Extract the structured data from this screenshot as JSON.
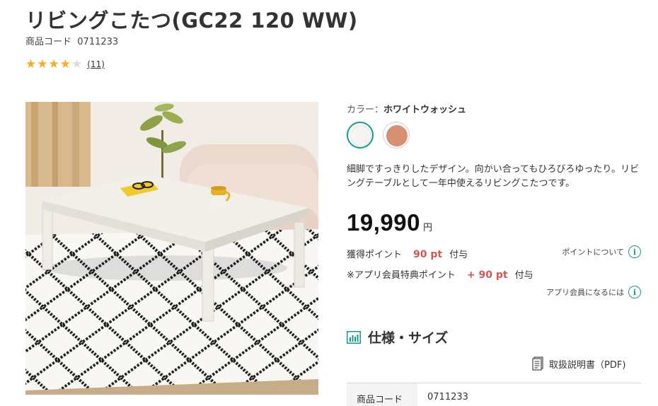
{
  "product": {
    "title": "リビングこたつ(GC22 120 WW)",
    "code_label": "商品コード",
    "code": "0711233",
    "rating": 4,
    "rating_max": 5,
    "review_count": "(11)"
  },
  "color": {
    "label": "カラー：",
    "selected": "ホワイトウォッシュ",
    "swatches": [
      {
        "name": "ホワイトウォッシュ",
        "hex": "#f7f5f2",
        "selected": true
      },
      {
        "name": "brown",
        "hex": "#d99072",
        "selected": false
      }
    ]
  },
  "description": "細脚ですっきりしたデザイン。向かい合ってもひろびろゆったり。リビングテーブルとして一年中使えるリビングこたつです。",
  "price": {
    "value": "19,990",
    "unit": "円"
  },
  "points": {
    "earn_label": "獲得ポイント",
    "earn_value": "90 pt",
    "earn_suffix": "付与",
    "about_link": "ポイントについて",
    "app_label": "※アプリ会員特典ポイント",
    "app_value": "+ 90 pt",
    "app_suffix": "付与",
    "app_link": "アプリ会員になるには"
  },
  "spec": {
    "heading": "仕様・サイズ",
    "manual_link": "取扱説明書（PDF)",
    "rows": [
      {
        "label": "商品コード",
        "value": "0711233"
      }
    ]
  },
  "colors": {
    "accent": "#159b8c",
    "point": "#d9534f",
    "star": "#f2b01e"
  }
}
